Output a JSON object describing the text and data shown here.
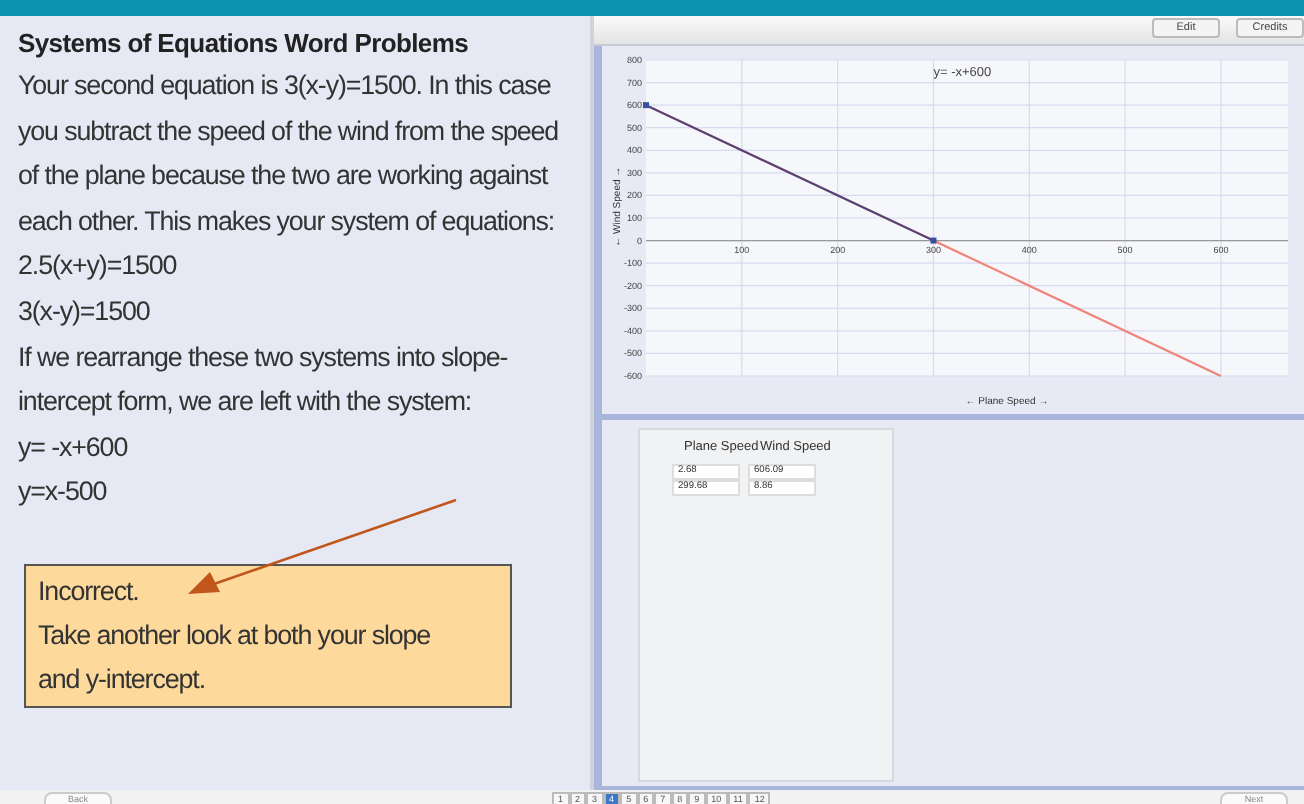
{
  "lesson": {
    "title": "Systems of Equations Word Problems",
    "paragraphs": [
      "Your second equation is 3(x-y)=1500. In this case you subtract the speed of the wind from the speed of the plane because the two are working against each other. This makes your system of equations:",
      "2.5(x+y)=1500",
      "3(x-y)=1500",
      "If we rearrange these two systems into slope-intercept form, we are left with the system:",
      "y= -x+600",
      "y=x-500"
    ],
    "feedback": {
      "lines": [
        "Incorrect.",
        "Take another look at both your slope and y-intercept."
      ]
    }
  },
  "toolbar": {
    "buttons": [
      "Edit",
      "Credits"
    ]
  },
  "graph": {
    "chart_data": {
      "type": "line",
      "xlabel": "← Plane Speed →",
      "ylabel": "← Wind Speed →",
      "x": [
        0,
        300,
        600
      ],
      "grid": true,
      "series": [
        {
          "color": "#5b3f6e",
          "marker": "square",
          "values": [
            600,
            0,
            null
          ]
        },
        {
          "color": "#f0837a",
          "values": [
            null,
            0,
            -600
          ]
        }
      ],
      "xlim": [
        0,
        670
      ],
      "ylim": [
        -600,
        800
      ],
      "xticks": [
        100,
        200,
        300,
        400,
        500,
        600
      ],
      "yticks": [
        -600,
        -500,
        -400,
        -300,
        -200,
        -100,
        0,
        100,
        200,
        300,
        400,
        500,
        600,
        700,
        800
      ],
      "annotations": [
        "y= -x+600"
      ]
    }
  },
  "table": {
    "columns": [
      "Plane Speed",
      "Wind Speed"
    ],
    "rows": [
      [
        "2.68",
        "606.09"
      ],
      [
        "299.68",
        "8.86"
      ]
    ]
  },
  "footer": {
    "back": "Back",
    "pages": [
      {
        "label": "1",
        "selected": false
      },
      {
        "label": "2",
        "selected": false
      },
      {
        "label": "3",
        "selected": false
      },
      {
        "label": "4",
        "selected": true
      },
      {
        "label": "5",
        "selected": false
      },
      {
        "label": "6",
        "selected": false
      },
      {
        "label": "7",
        "selected": false
      },
      {
        "label": "8",
        "selected": false
      },
      {
        "label": "9",
        "selected": false
      },
      {
        "label": "10",
        "selected": false
      },
      {
        "label": "11",
        "selected": false
      },
      {
        "label": "12",
        "selected": false
      }
    ],
    "next": "Next"
  }
}
